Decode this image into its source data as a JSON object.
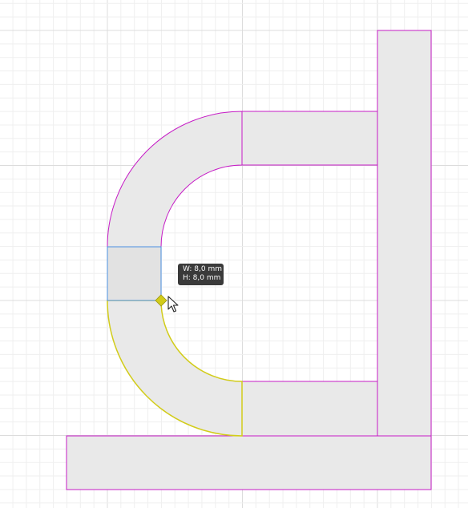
{
  "tooltip": {
    "width_label": "W: 8,0 mm",
    "height_label": "H: 8,0 mm"
  },
  "colors": {
    "canvas_background": "#ffffff",
    "grid_minor": "#efefef",
    "grid_major": "#dcdcdc",
    "shape_fill": "#e9e9e9",
    "selected_fill": "#e2e2e2",
    "shape_outline": "#c61cc6",
    "selection_outline": "#d2cc1a",
    "active_outline": "#4a90e2",
    "handle": "#d2cc1a",
    "tooltip_background": "#3a3a3a",
    "tooltip_text": "#ffffff"
  },
  "icons": {
    "cursor": "mouse-pointer-icon",
    "handle": "diamond-handle-icon"
  }
}
